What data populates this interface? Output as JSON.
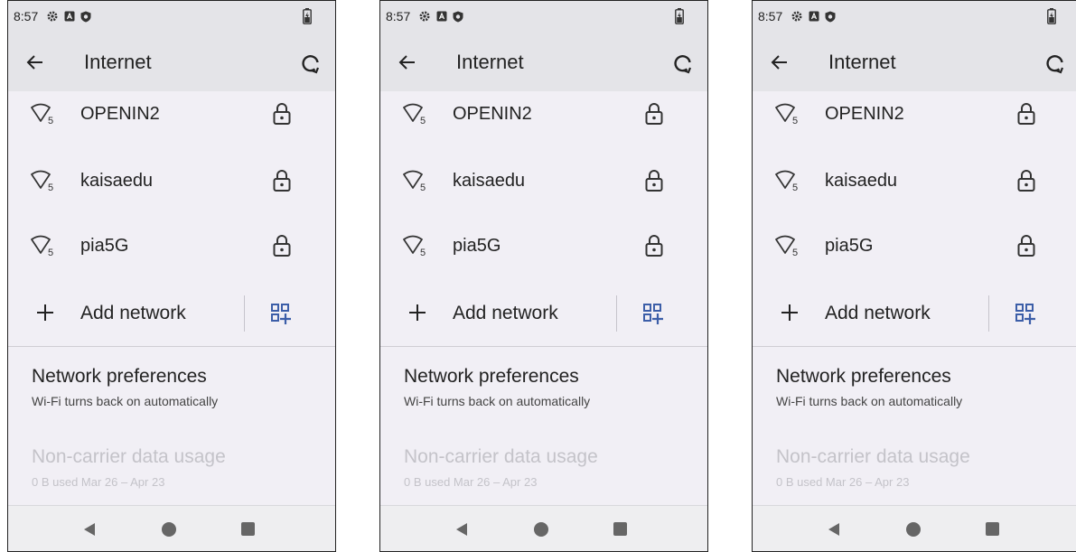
{
  "status": {
    "time": "8:57"
  },
  "appbar": {
    "title": "Internet"
  },
  "networks": [
    {
      "name": "OPENIN2",
      "band": "5"
    },
    {
      "name": "kaisaedu",
      "band": "5"
    },
    {
      "name": "pia5G",
      "band": "5"
    }
  ],
  "add_network": {
    "label": "Add network"
  },
  "preferences": {
    "title": "Network preferences",
    "subtitle": "Wi-Fi turns back on automatically"
  },
  "usage": {
    "title": "Non-carrier data usage",
    "subtitle": "0 B used Mar 26 – Apr 23"
  },
  "colors": {
    "accent": "#3c5ea8",
    "disabled_text": "#c4c3c9",
    "background": "#f1eff5",
    "header": "#e4e4e8"
  },
  "icons": [
    "settings-gear-icon",
    "a-box-icon",
    "shield-icon",
    "battery-icon",
    "back-arrow-icon",
    "refresh-icon",
    "wifi-5ghz-icon",
    "lock-icon",
    "plus-icon",
    "qr-code-icon"
  ]
}
